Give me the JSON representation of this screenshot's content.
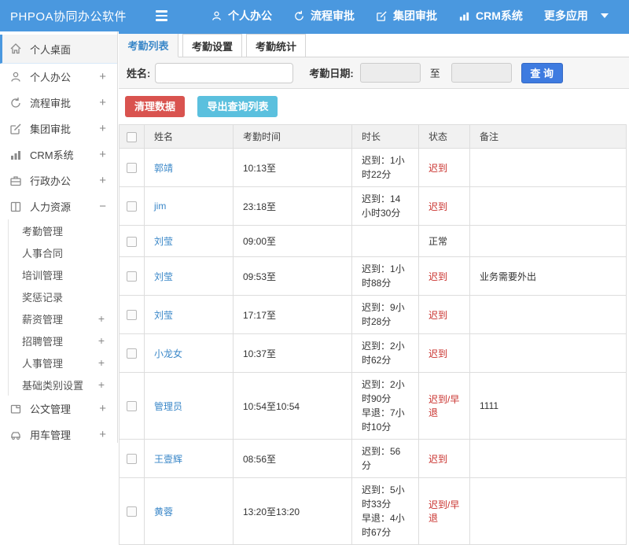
{
  "topbar": {
    "logo": "PHPOA协同办公软件",
    "nav": [
      {
        "label": "个人办公"
      },
      {
        "label": "流程审批"
      },
      {
        "label": "集团审批"
      },
      {
        "label": "CRM系统"
      },
      {
        "label": "更多应用"
      }
    ]
  },
  "sidebar": {
    "items": [
      {
        "label": "个人桌面",
        "expand": ""
      },
      {
        "label": "个人办公",
        "expand": "+"
      },
      {
        "label": "流程审批",
        "expand": "+"
      },
      {
        "label": "集团审批",
        "expand": "+"
      },
      {
        "label": "CRM系统",
        "expand": "+"
      },
      {
        "label": "行政办公",
        "expand": "+"
      },
      {
        "label": "人力资源",
        "expand": "−",
        "children": [
          {
            "label": "考勤管理",
            "expand": ""
          },
          {
            "label": "人事合同",
            "expand": ""
          },
          {
            "label": "培训管理",
            "expand": ""
          },
          {
            "label": "奖惩记录",
            "expand": ""
          },
          {
            "label": "薪资管理",
            "expand": "+"
          },
          {
            "label": "招聘管理",
            "expand": "+"
          },
          {
            "label": "人事管理",
            "expand": "+"
          },
          {
            "label": "基础类别设置",
            "expand": "+"
          }
        ]
      },
      {
        "label": "公文管理",
        "expand": "+"
      },
      {
        "label": "用车管理",
        "expand": "+"
      }
    ]
  },
  "tabs": [
    {
      "label": "考勤列表"
    },
    {
      "label": "考勤设置"
    },
    {
      "label": "考勤统计"
    }
  ],
  "filter": {
    "name_label": "姓名:",
    "date_label": "考勤日期:",
    "to_label": "至",
    "search_button": "查 询"
  },
  "toolbar": {
    "clean_button": "清理数据",
    "export_button": "导出查询列表"
  },
  "table": {
    "headers": {
      "name": "姓名",
      "time": "考勤时间",
      "duration": "时长",
      "status": "状态",
      "note": "备注"
    },
    "rows": [
      {
        "name": "郭靖",
        "time": "10:13至",
        "dur1": "迟到：1小时22分",
        "status": "迟到",
        "note": ""
      },
      {
        "name": "jim",
        "time": "23:18至",
        "dur1": "迟到：14小时30分",
        "status": "迟到",
        "note": ""
      },
      {
        "name": "刘莹",
        "time": "09:00至",
        "dur1": "",
        "status": "正常",
        "note": ""
      },
      {
        "name": "刘莹",
        "time": "09:53至",
        "dur1": "迟到：1小时88分",
        "status": "迟到",
        "note": "业务需要外出"
      },
      {
        "name": "刘莹",
        "time": "17:17至",
        "dur1": "迟到：9小时28分",
        "status": "迟到",
        "note": ""
      },
      {
        "name": "小龙女",
        "time": "10:37至",
        "dur1": "迟到：2小时62分",
        "status": "迟到",
        "note": ""
      },
      {
        "name": "管理员",
        "time": "10:54至10:54",
        "dur1": "迟到：2小时90分",
        "dur2": "早退：7小时10分",
        "status": "迟到/早退",
        "note": "1111"
      },
      {
        "name": "王壹辉",
        "time": "08:56至",
        "dur1": "迟到：56分",
        "status": "迟到",
        "note": ""
      },
      {
        "name": "黄蓉",
        "time": "13:20至13:20",
        "dur1": "迟到：5小时33分",
        "dur2": "早退：4小时67分",
        "status": "迟到/早退",
        "note": ""
      }
    ]
  },
  "colors": {
    "topbar_blue": "#4a98df",
    "link_blue": "#3a87c8",
    "search_button_blue": "#3e7be0",
    "danger_red": "#d9534f",
    "info_teal": "#5bc0de",
    "status_red": "#c9302c"
  }
}
